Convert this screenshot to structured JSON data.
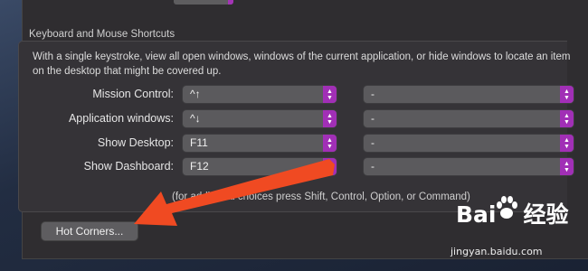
{
  "group": {
    "title": "Keyboard and Mouse Shortcuts",
    "description": "With a single keystroke, view all open windows, windows of the current application, or hide windows to locate an item on the desktop that might be covered up."
  },
  "rows": [
    {
      "label": "Mission Control:",
      "shortcut": "^↑",
      "modifier": "-"
    },
    {
      "label": "Application windows:",
      "shortcut": "^↓",
      "modifier": "-"
    },
    {
      "label": "Show Desktop:",
      "shortcut": "F11",
      "modifier": "-"
    },
    {
      "label": "Show Dashboard:",
      "shortcut": "F12",
      "modifier": "-"
    }
  ],
  "footnote": "(for additional choices press Shift, Control, Option, or Command)",
  "hot_corners_label": "Hot Corners...",
  "colors": {
    "accent": "#a12fb6",
    "arrow": "#f04a22"
  },
  "watermark": {
    "logo_left": "Bai",
    "logo_right": "经验",
    "url": "jingyan.baidu.com"
  }
}
